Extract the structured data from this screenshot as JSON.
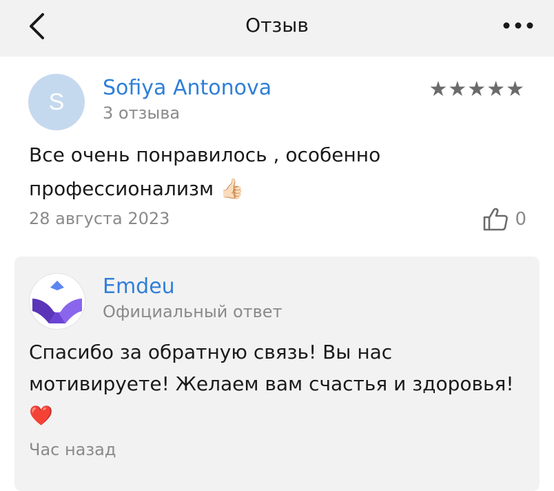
{
  "header": {
    "title": "Отзыв",
    "back_icon": "chevron-left-icon",
    "more_icon": "more-horizontal-icon"
  },
  "review": {
    "author_initial": "S",
    "author_name": "Sofiya Antonova",
    "author_reviews": "3 отзыва",
    "rating": 5,
    "rating_max": 5,
    "stars_text": "★★★★★",
    "text": "Все очень понравилось , особенно профессионализм 👍🏻",
    "date": "28 августа 2023",
    "likes": "0"
  },
  "reply": {
    "company_name": "Emdeu",
    "label": "Официальный ответ",
    "text": "Спасибо за обратную связь! Вы нас мотивируете! Желаем вам счастья и здоровья! ❤️",
    "time": "Час назад"
  },
  "colors": {
    "link": "#2f7fd8",
    "muted": "#8a8a8a",
    "header_bg": "#f2f2f2",
    "avatar_bg": "#c5d9ee",
    "logo_purple": "#6b44d6",
    "logo_blue": "#5e86f0"
  }
}
